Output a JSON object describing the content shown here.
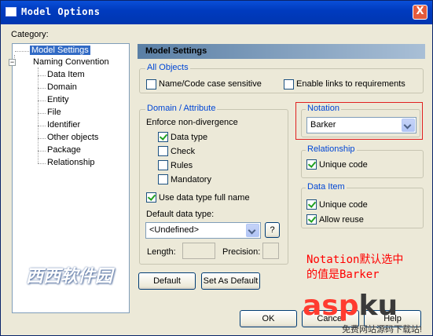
{
  "window": {
    "title": "Model Options",
    "close_label": "X"
  },
  "category": {
    "label": "Category:",
    "tree": {
      "selected": "Model Settings",
      "items": [
        "Model Settings",
        "Naming Convention",
        "Data Item",
        "Domain",
        "Entity",
        "File",
        "Identifier",
        "Other objects",
        "Package",
        "Relationship"
      ],
      "expander": "−"
    }
  },
  "panel": {
    "header": "Model Settings",
    "all_objects": {
      "title": "All Objects",
      "name_code_case": {
        "label": "Name/Code case sensitive",
        "checked": false
      },
      "enable_links": {
        "label": "Enable links to requirements",
        "checked": false
      }
    },
    "domain_attribute": {
      "title": "Domain / Attribute",
      "enforce_label": "Enforce non-divergence",
      "data_type": {
        "label": "Data type",
        "checked": true
      },
      "check": {
        "label": "Check",
        "checked": false
      },
      "rules": {
        "label": "Rules",
        "checked": false
      },
      "mandatory": {
        "label": "Mandatory",
        "checked": false
      },
      "use_full_name": {
        "label": "Use data type full name",
        "checked": true
      },
      "default_type_label": "Default data type:",
      "default_type_value": "<Undefined>",
      "help_button": "?",
      "length_label": "Length:",
      "precision_label": "Precision:"
    },
    "notation": {
      "title": "Notation",
      "value": "Barker"
    },
    "relationship": {
      "title": "Relationship",
      "unique_code": {
        "label": "Unique code",
        "checked": true
      }
    },
    "data_item": {
      "title": "Data Item",
      "unique_code": {
        "label": "Unique code",
        "checked": true
      },
      "allow_reuse": {
        "label": "Allow reuse",
        "checked": true
      }
    },
    "buttons": {
      "default": "Default",
      "set_as_default": "Set As Default"
    }
  },
  "dialog_buttons": {
    "ok": "OK",
    "cancel": "Cancel",
    "help": "Help"
  },
  "annotation": {
    "line1": "Notation默认选中",
    "line2": "的值是Barker"
  },
  "watermarks": {
    "left": "西西软件园",
    "asp": "asp",
    "ku": "ku",
    "sub": "免费网站源码下载站!"
  },
  "colors": {
    "titlebar": "#0a4fd8",
    "annotation": "#ff0000",
    "group_title": "#0046d5"
  }
}
